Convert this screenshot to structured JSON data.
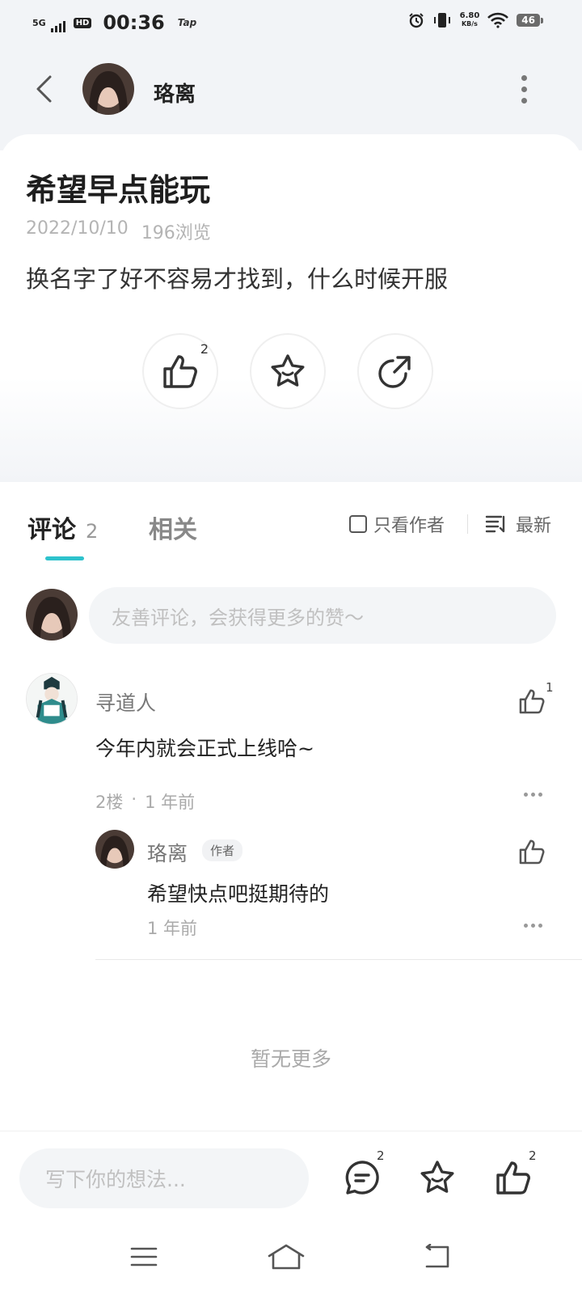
{
  "status_bar": {
    "network": "5G",
    "hd_label": "HD",
    "time": "00:36",
    "app_label": "Tap",
    "speed_value": "6.80",
    "speed_unit": "KB/s",
    "battery": "46"
  },
  "header": {
    "author_name": "珞离"
  },
  "post": {
    "title": "希望早点能玩",
    "date": "2022/10/10",
    "views": "196浏览",
    "body": "换名字了好不容易才找到，什么时候开服",
    "like_count": "2"
  },
  "tabs": {
    "comments_label": "评论",
    "comments_count": "2",
    "related_label": "相关",
    "author_only_label": "只看作者",
    "sort_label": "最新"
  },
  "comment_input": {
    "placeholder": "友善评论，会获得更多的赞～"
  },
  "comments": [
    {
      "user": "寻道人",
      "text": "今年内就会正式上线哈~",
      "floor": "2楼",
      "time": "1 年前",
      "like_count": "1",
      "replies": [
        {
          "user": "珞离",
          "badge": "作者",
          "text": "希望快点吧挺期待的",
          "time": "1 年前"
        }
      ]
    }
  ],
  "list_end_text": "暂无更多",
  "bottom_bar": {
    "placeholder": "写下你的想法...",
    "comment_count": "2",
    "like_count": "2"
  }
}
